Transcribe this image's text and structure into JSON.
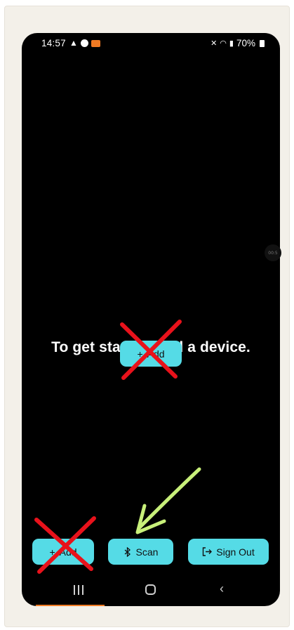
{
  "status_bar": {
    "time": "14:57",
    "battery": "70%"
  },
  "side_timer": "00:5",
  "main": {
    "prompt": "To get started, add a device.",
    "add_button": {
      "icon": "+",
      "label": "Add"
    }
  },
  "bottom_bar": {
    "add_button": {
      "icon": "+",
      "label": "Add"
    },
    "scan_button": {
      "icon": "bluetooth-icon",
      "label": "Scan"
    },
    "signout_button": {
      "icon": "sign-out-icon",
      "label": "Sign Out"
    }
  },
  "colors": {
    "accent": "#55dbe6",
    "strike": "#e8121b",
    "arrow": "#c8f07a"
  }
}
